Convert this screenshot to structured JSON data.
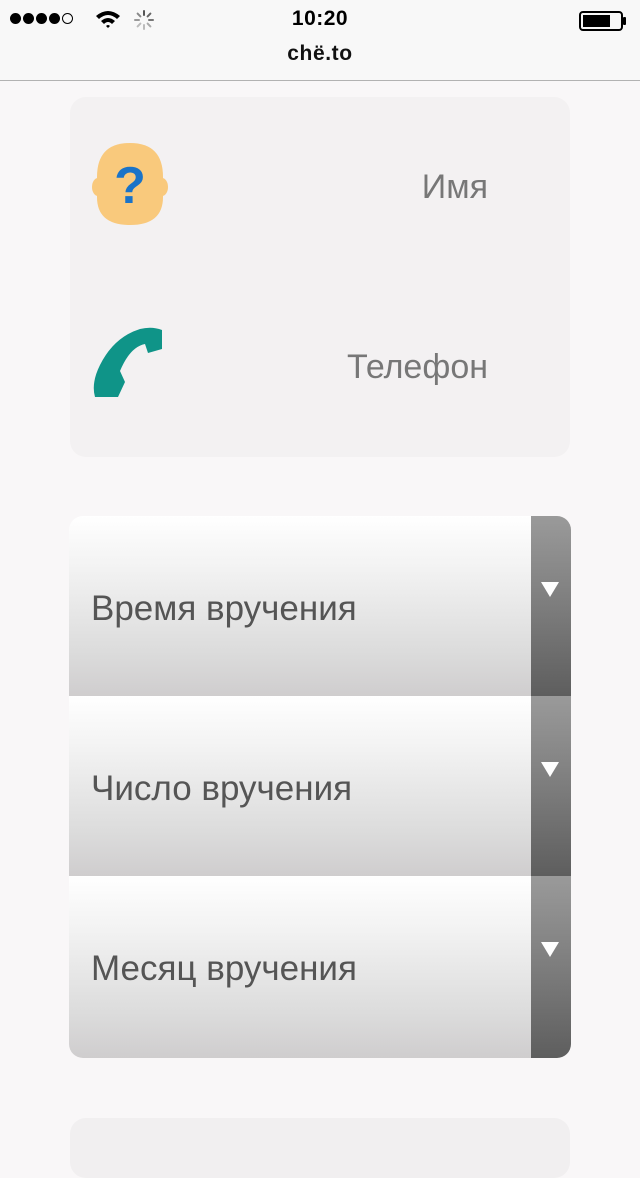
{
  "status_bar": {
    "time": "10:20",
    "signal_filled": 4,
    "signal_total": 5
  },
  "url_bar": {
    "domain": "chë.to"
  },
  "contact": {
    "name_label": "Имя",
    "phone_label": "Телефон",
    "name_icon": "question-head-icon",
    "phone_icon": "phone-handset-icon",
    "colors": {
      "head": "#f9c97c",
      "question": "#1a73c8",
      "phone": "#0f9488"
    }
  },
  "selects": [
    {
      "label": "Время вручения"
    },
    {
      "label": "Число вручения"
    },
    {
      "label": "Месяц вручения"
    }
  ]
}
